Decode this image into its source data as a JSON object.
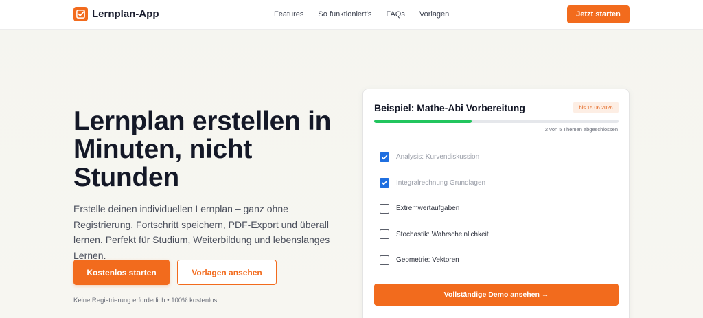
{
  "header": {
    "brand": "Lernplan-App",
    "logo_icon": "checkmark-box-icon",
    "nav": [
      {
        "label": "Features"
      },
      {
        "label": "So funktioniert's"
      },
      {
        "label": "FAQs"
      },
      {
        "label": "Vorlagen"
      }
    ],
    "cta_label": "Jetzt starten"
  },
  "hero": {
    "title": "Lernplan erstellen in Minuten, nicht Stunden",
    "subtitle": "Erstelle deinen individuellen Lernplan – ganz ohne Registrierung. Fortschritt speichern, PDF-Export und überall lernen. Perfekt für Studium, Weiterbildung und lebenslanges Lernen.",
    "primary_button": "Kostenlos starten",
    "secondary_button": "Vorlagen ansehen",
    "note": "Keine Registrierung erforderlich • 100% kostenlos"
  },
  "demo_card": {
    "title": "Beispiel: Mathe-Abi Vorbereitung",
    "date_badge": "bis 15.06.2026",
    "progress": {
      "completed": 2,
      "total": 5,
      "fraction": 0.4
    },
    "progress_text": "2 von 5 Themen abgeschlossen",
    "topics": [
      {
        "label": "Analysis: Kurvendiskussion",
        "checked": true
      },
      {
        "label": "Integralrechnung Grundlagen",
        "checked": true
      },
      {
        "label": "Extremwertaufgaben",
        "checked": false
      },
      {
        "label": "Stochastik: Wahrscheinlichkeit",
        "checked": false
      },
      {
        "label": "Geometrie: Vektoren",
        "checked": false
      }
    ],
    "cta_label": "Vollständige Demo ansehen →"
  },
  "colors": {
    "accent": "#f26b1d",
    "progress": "#22c55e",
    "checkbox": "#1f6fe0"
  }
}
